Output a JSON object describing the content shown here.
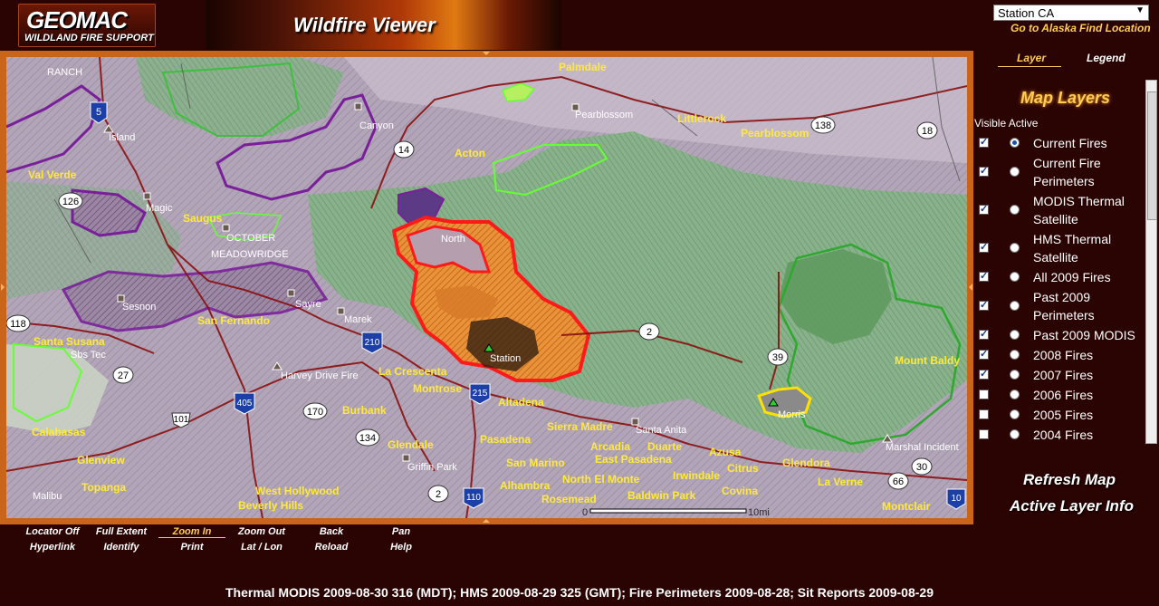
{
  "header": {
    "logo_text": "GEOMAC",
    "logo_sub": "WILDLAND FIRE SUPPORT",
    "banner_title": "Wildfire Viewer"
  },
  "station_select": {
    "value": "Station CA"
  },
  "top_links": {
    "alaska": "Go to Alaska",
    "find_location": "Find Location"
  },
  "panel": {
    "tabs": {
      "layer": "Layer",
      "legend": "Legend"
    },
    "title": "Map Layers",
    "col_heads": "Visible Active",
    "layers": [
      {
        "name": "Current Fires",
        "visible": true,
        "active": true
      },
      {
        "name": "Current Fire Perimeters",
        "visible": true,
        "active": false
      },
      {
        "name": "MODIS Thermal Satellite",
        "visible": true,
        "active": false
      },
      {
        "name": "HMS Thermal Satellite",
        "visible": true,
        "active": false
      },
      {
        "name": "All 2009 Fires",
        "visible": true,
        "active": false
      },
      {
        "name": "Past 2009 Perimeters",
        "visible": true,
        "active": false
      },
      {
        "name": "Past 2009 MODIS",
        "visible": true,
        "active": false
      },
      {
        "name": "2008 Fires",
        "visible": true,
        "active": false
      },
      {
        "name": "2007 Fires",
        "visible": true,
        "active": false
      },
      {
        "name": "2006 Fires",
        "visible": false,
        "active": false
      },
      {
        "name": "2005 Fires",
        "visible": false,
        "active": false
      },
      {
        "name": "2004 Fires",
        "visible": false,
        "active": false
      }
    ],
    "refresh": "Refresh Map",
    "active_info": "Active Layer Info"
  },
  "toolbar": {
    "row1": [
      "Locator Off",
      "Full Extent",
      "Zoom In",
      "Zoom Out",
      "Back",
      "Pan"
    ],
    "row2": [
      "Hyperlink",
      "Identify",
      "Print",
      "Lat / Lon",
      "Reload",
      "Help"
    ],
    "active": "Zoom In"
  },
  "map": {
    "places": {
      "palmdale": "Palmdale",
      "pearblossom": "Pearblossom",
      "pearblossom_small": "Pearblossom",
      "littlerock": "Littlerock",
      "acton": "Acton",
      "val_verde": "Val Verde",
      "saugus": "Saugus",
      "san_fernando": "San Fernando",
      "santa_susana": "Santa Susana",
      "calabasas": "Calabasas",
      "glenview": "Glenview",
      "topanga": "Topanga",
      "west_hollywood": "West Hollywood",
      "beverly_hills": "Beverly Hills",
      "burbank": "Burbank",
      "glendale": "Glendale",
      "la_crescenta": "La Crescenta",
      "montrose": "Montrose",
      "altadena": "Altadena",
      "pasadena": "Pasadena",
      "sierra_madre": "Sierra Madre",
      "arcadia": "Arcadia",
      "duarte": "Duarte",
      "east_pasadena": "East Pasadena",
      "san_marino": "San Marino",
      "north_el_monte": "North El Monte",
      "alhambra": "Alhambra",
      "rosemead": "Rosemead",
      "baldwin_park": "Baldwin Park",
      "irwindale": "Irwindale",
      "azusa": "Azusa",
      "citrus": "Citrus",
      "covina": "Covina",
      "glendora": "Glendora",
      "la_verne": "La Verne",
      "montclair": "Montclair",
      "mount_baldy": "Mount Baldy"
    },
    "features": {
      "ranch": "RANCH",
      "island": "Island",
      "canyon": "Canyon",
      "magic": "Magic",
      "october": "OCTOBER",
      "meadowridge": "MEADOWRIDGE",
      "sesnon": "Sesnon",
      "sayre": "Sayre",
      "marek": "Marek",
      "north": "North",
      "station": "Station",
      "morris": "Morris",
      "harvey_drive": "Harvey Drive Fire",
      "griffin_park": "Griffin Park",
      "santa_anita": "Santa Anita",
      "marshal": "Marshal Incident",
      "sbs_tec": "Sbs Tec",
      "malibu": "Malibu"
    },
    "shields": {
      "i5": "5",
      "r14": "14",
      "r138": "138",
      "r18": "18",
      "r126": "126",
      "r118": "118",
      "r27": "27",
      "i210": "210",
      "i405": "405",
      "r101": "101",
      "r170": "170",
      "r134": "134",
      "i215": "215",
      "r2a": "2",
      "r2b": "2",
      "i110": "110",
      "r39": "39",
      "r66": "66",
      "r30": "30",
      "i10": "10"
    },
    "scale": {
      "zero": "0",
      "ten": "10mi"
    }
  },
  "footer": "Thermal MODIS 2009-08-30 316 (MDT); HMS 2009-08-29 325 (GMT); Fire Perimeters 2009-08-28; Sit Reports 2009-08-29",
  "colors": {
    "background": "#2a0303",
    "frame": "#c9651a",
    "fire_perimeter": "#ff1a1a",
    "thermal": "#ff9a1a",
    "forest": "#7fae7f",
    "accent": "#ffcc55"
  }
}
